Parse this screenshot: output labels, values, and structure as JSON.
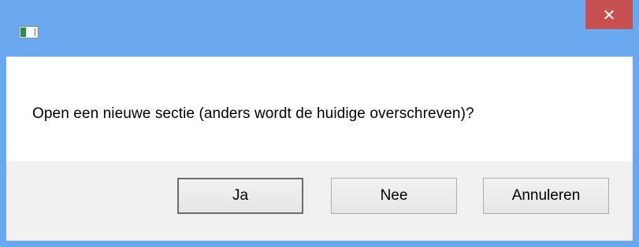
{
  "window": {
    "title": "",
    "close_glyph": "✕",
    "app_icon": "application-icon"
  },
  "dialog": {
    "message": "Open een nieuwe sectie (anders wordt de huidige overschreven)?"
  },
  "buttons": {
    "yes_label": "Ja",
    "no_label": "Nee",
    "cancel_label": "Annuleren"
  },
  "colors": {
    "titlebar": "#6aa9ef",
    "close_button": "#c75050",
    "button_area": "#f0f0f0"
  }
}
